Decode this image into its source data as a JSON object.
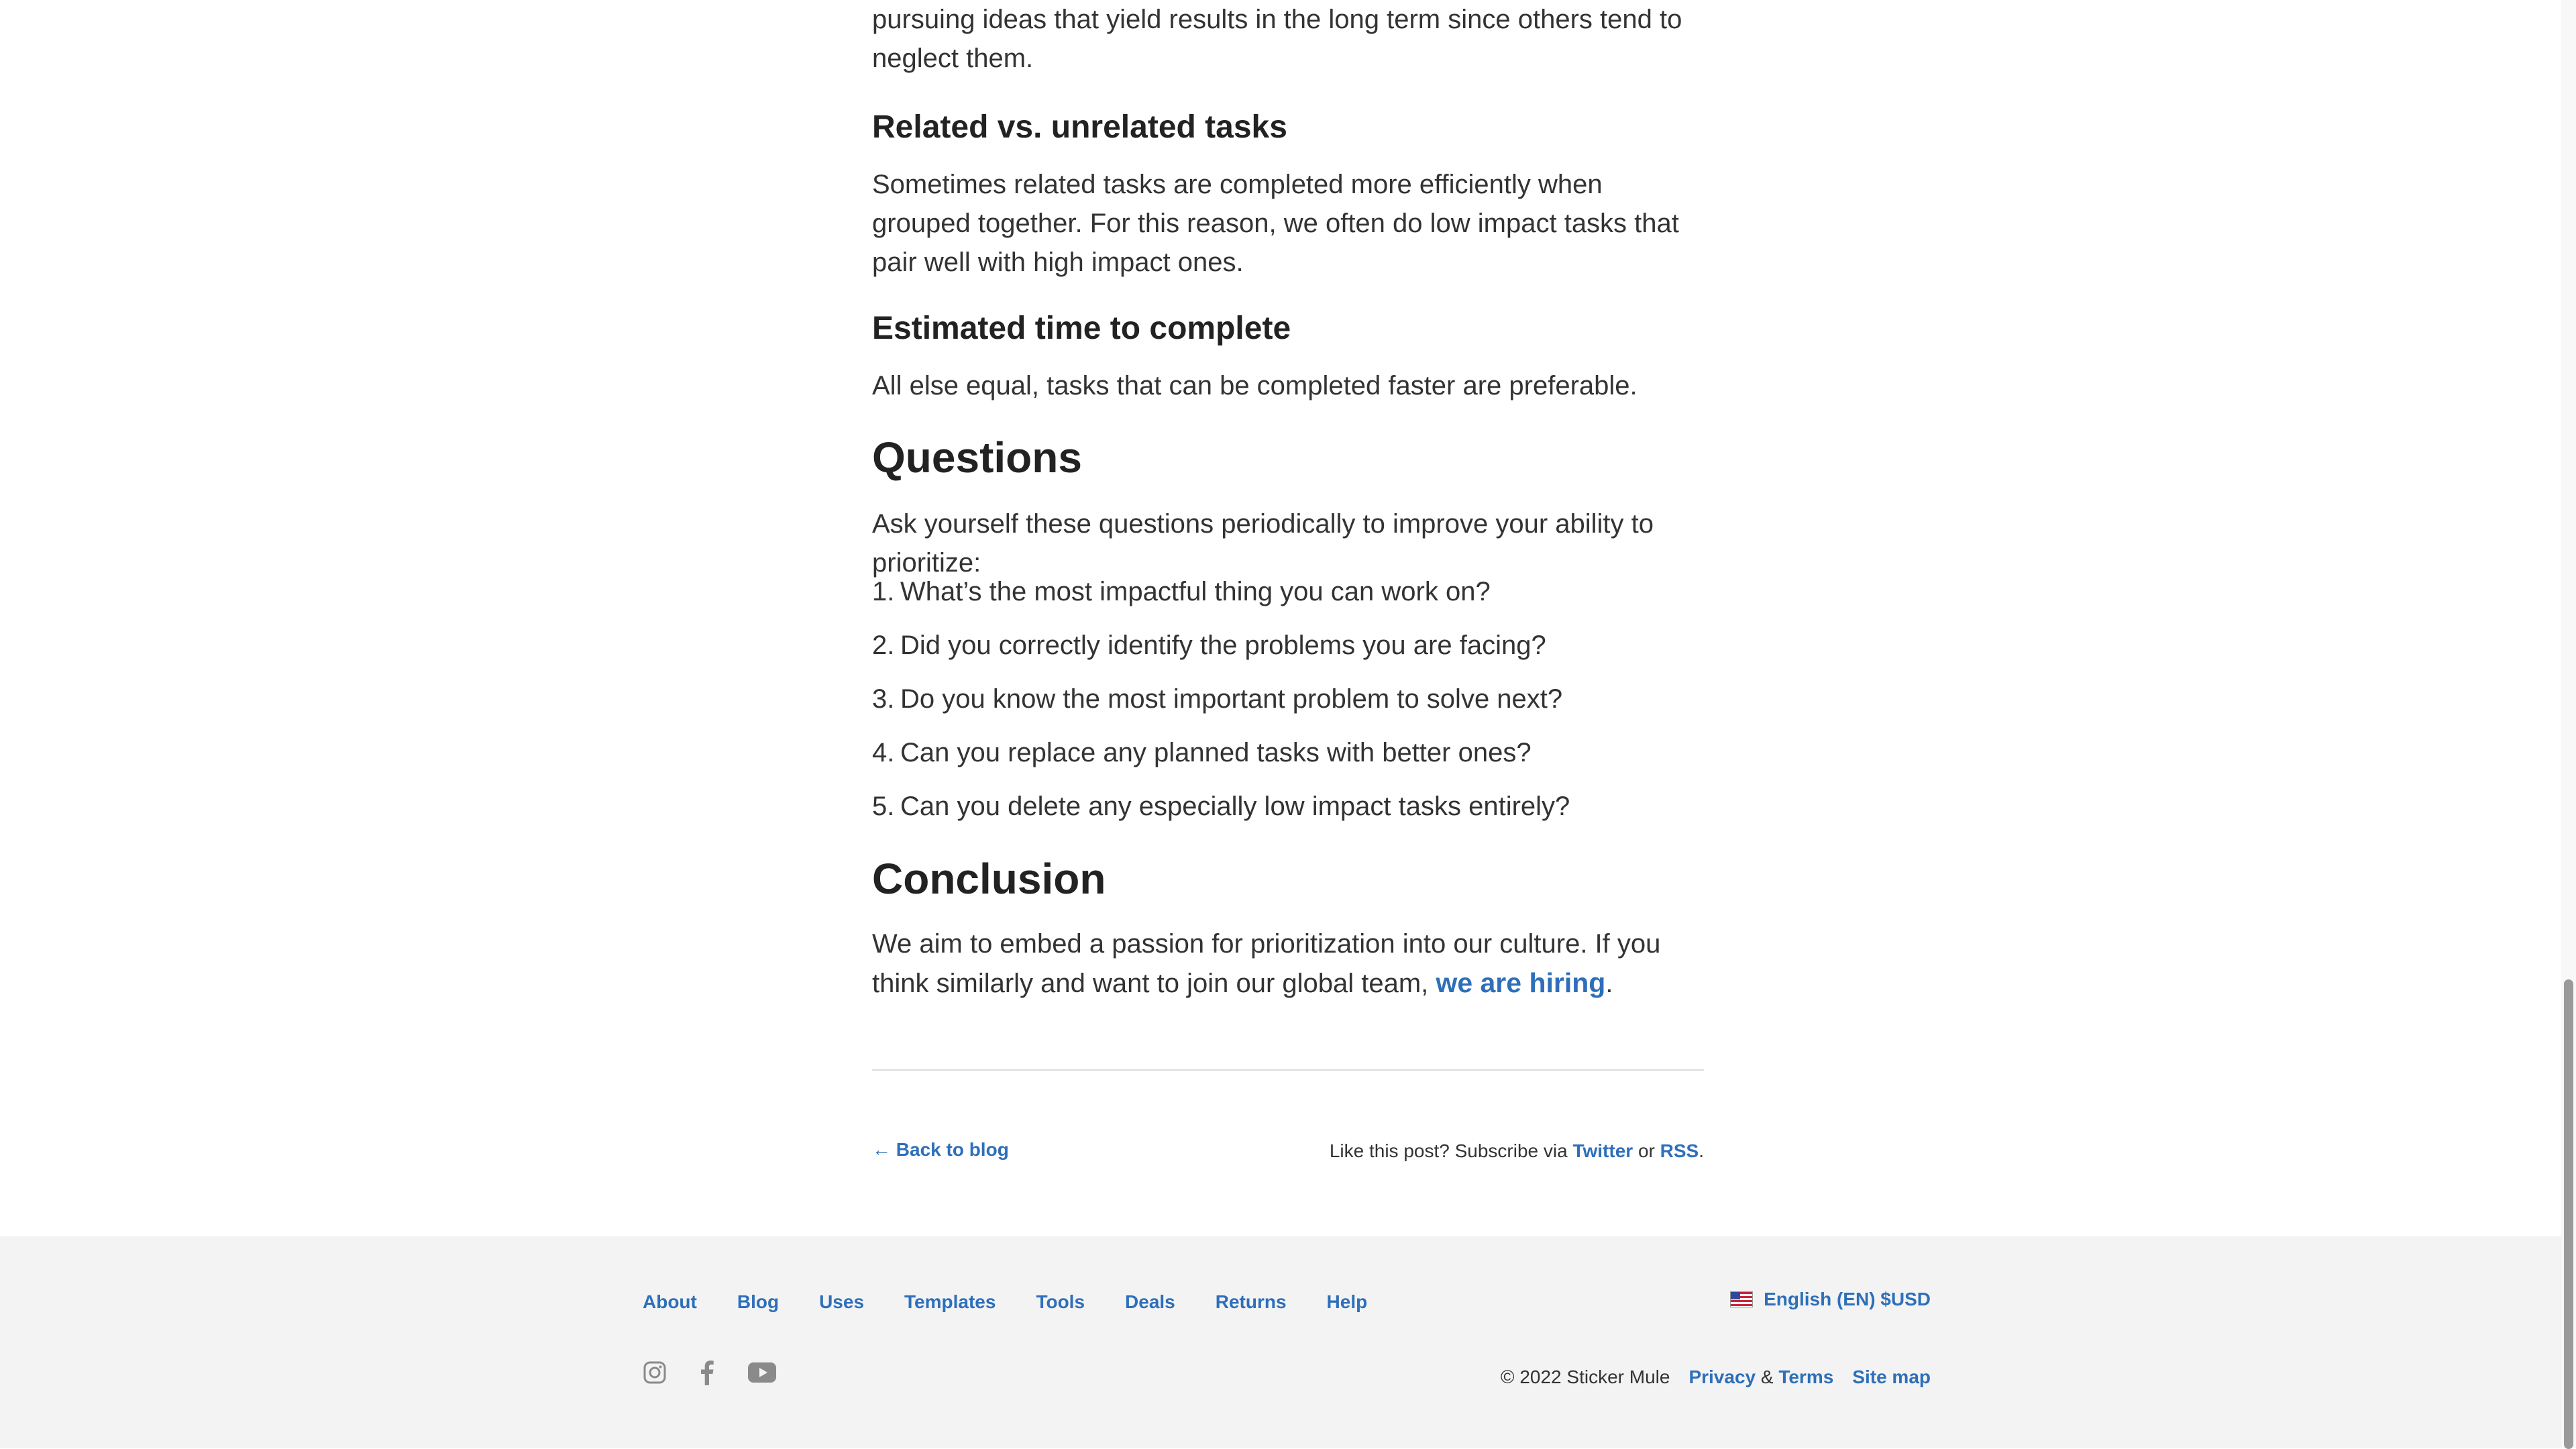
{
  "article": {
    "intro_tail": "pursuing ideas that yield results in the long term since others tend to neglect them.",
    "related_heading": "Related vs. unrelated tasks",
    "related_text": "Sometimes related tasks are completed more efficiently when grouped together. For this reason, we often do low impact tasks that pair well with high impact ones.",
    "time_heading": "Estimated time to complete",
    "time_text": "All else equal, tasks that can be completed faster are preferable.",
    "questions_heading": "Questions",
    "questions_intro": "Ask yourself these questions periodically to improve your ability to prioritize:",
    "questions": [
      {
        "num": "1.",
        "text": "What’s the most impactful thing you can work on?"
      },
      {
        "num": "2.",
        "text": "Did you correctly identify the problems you are facing?"
      },
      {
        "num": "3.",
        "text": "Do you know the most important problem to solve next?"
      },
      {
        "num": "4.",
        "text": "Can you replace any planned tasks with better ones?"
      },
      {
        "num": "5.",
        "text": "Can you delete any especially low impact tasks entirely?"
      }
    ],
    "conclusion_heading": "Conclusion",
    "conclusion_text": "We aim to embed a passion for prioritization into our culture. If you think similarly and want to join our global team, ",
    "hiring_link": "we are hiring",
    "conclusion_end": "."
  },
  "post_nav": {
    "back_link": "← Back to blog",
    "subscribe_prefix": "Like this post? Subscribe via ",
    "twitter": "Twitter",
    "or": " or ",
    "rss": "RSS",
    "end": "."
  },
  "footer": {
    "nav": [
      "About",
      "Blog",
      "Uses",
      "Templates",
      "Tools",
      "Deals",
      "Returns",
      "Help"
    ],
    "language": "English (EN) $USD",
    "social_icons": [
      "instagram-icon",
      "facebook-icon",
      "youtube-icon"
    ],
    "copyright": "© 2022 Sticker Mule",
    "privacy": "Privacy",
    "amp": " & ",
    "terms": "Terms",
    "sitemap": "Site map"
  },
  "colors": {
    "link": "#2e6fba",
    "text": "#333333",
    "footer_bg": "#f3f3f3"
  }
}
